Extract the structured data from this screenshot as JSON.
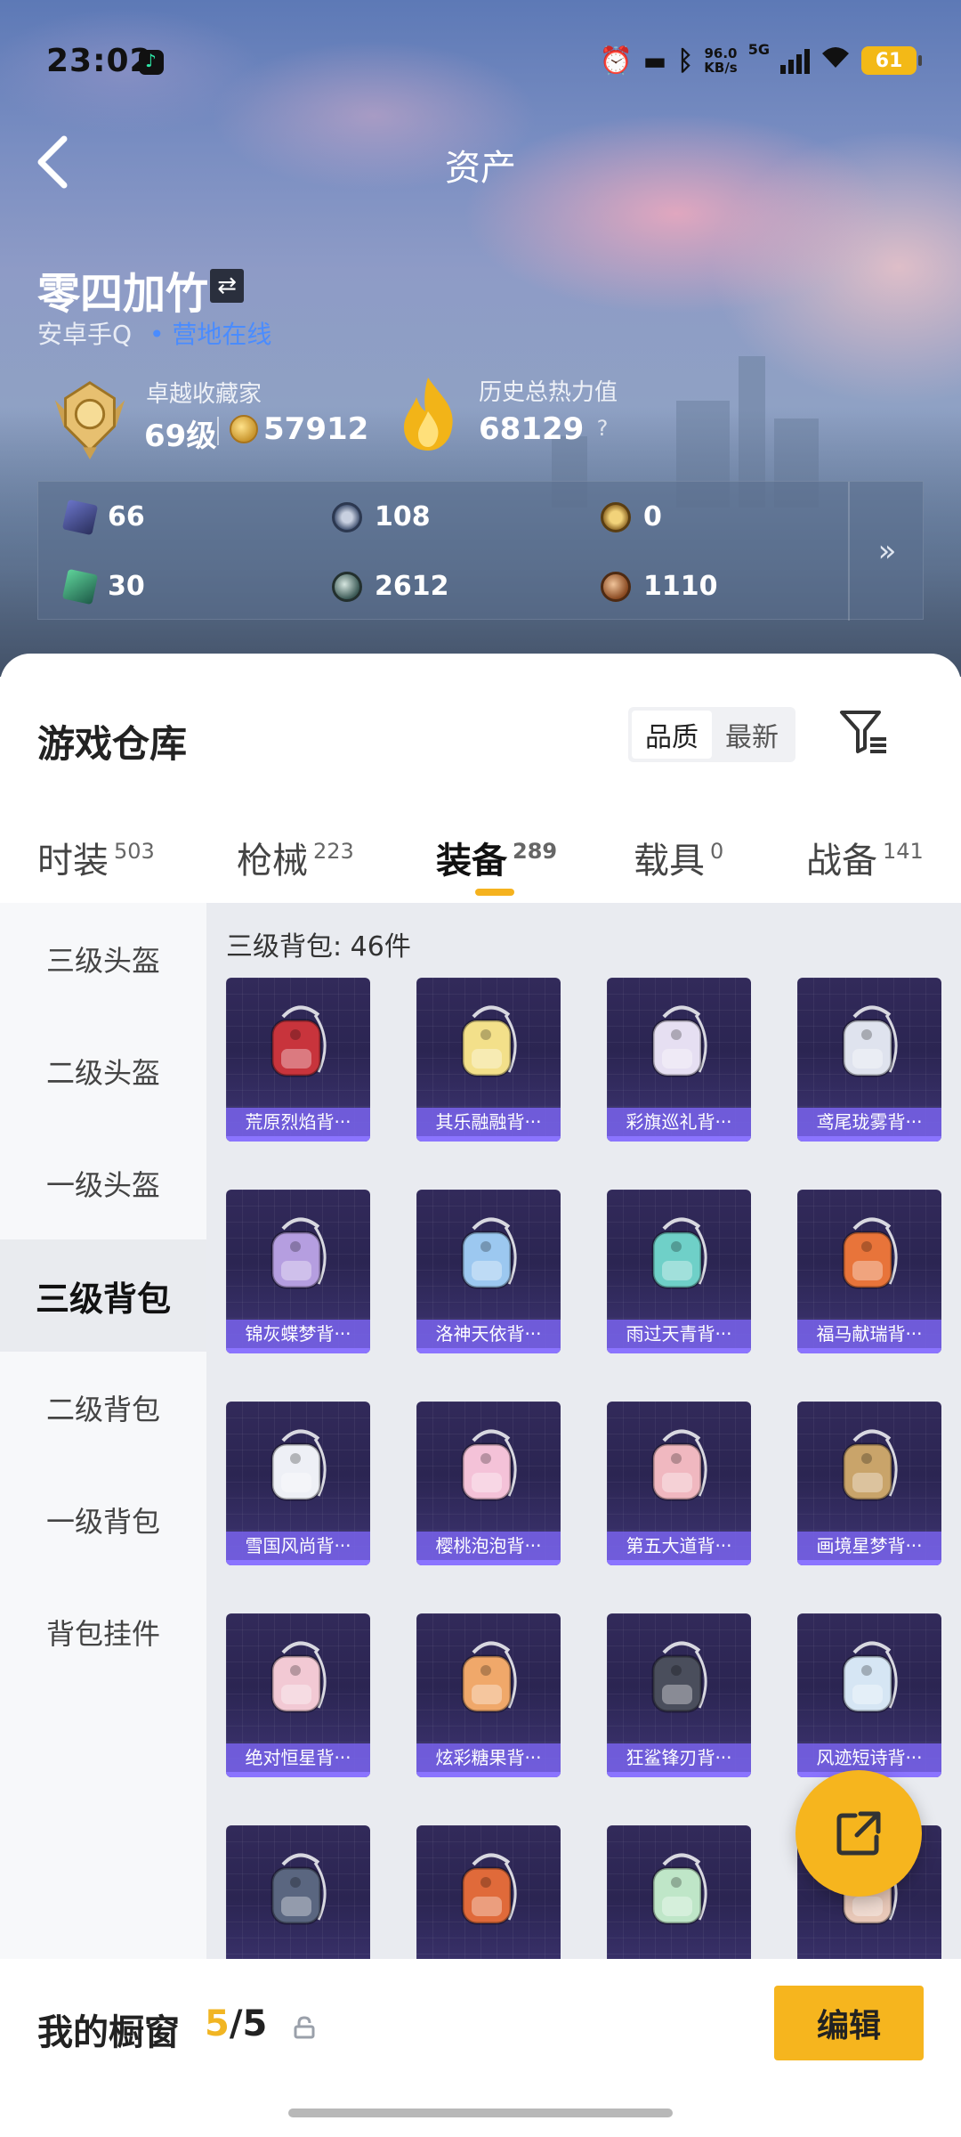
{
  "status_bar": {
    "time": "23:02",
    "net_speed_value": "96.0",
    "net_speed_unit": "KB/s",
    "network_type": "5G",
    "battery": "61"
  },
  "header": {
    "title": "资产"
  },
  "profile": {
    "name": "零四加竹",
    "platform": "安卓手Q",
    "online_status": "• 营地在线",
    "collector_title": "卓越收藏家",
    "level": "69级",
    "collection_points": "57912",
    "heat_label": "历史总热力值",
    "heat_value": "68129",
    "help_symbol": "?"
  },
  "resources": [
    {
      "icon": "card-icon",
      "value": "66"
    },
    {
      "icon": "gear-badge-icon",
      "value": "108"
    },
    {
      "icon": "gold-emblem-icon",
      "value": "0"
    },
    {
      "icon": "green-card-icon",
      "value": "30"
    },
    {
      "icon": "silver-orb-icon",
      "value": "2612"
    },
    {
      "icon": "bronze-coin-icon",
      "value": "1110"
    }
  ],
  "resources_more": "»",
  "warehouse": {
    "title": "游戏仓库",
    "sort_options": [
      "品质",
      "最新"
    ],
    "active_sort": "品质"
  },
  "tabs": [
    {
      "label": "时装",
      "count": "503"
    },
    {
      "label": "枪械",
      "count": "223"
    },
    {
      "label": "装备",
      "count": "289"
    },
    {
      "label": "载具",
      "count": "0"
    },
    {
      "label": "战备",
      "count": "141"
    }
  ],
  "active_tab": "装备",
  "sidebar": [
    {
      "label": "三级头盔"
    },
    {
      "label": "二级头盔"
    },
    {
      "label": "一级头盔"
    },
    {
      "label": "三级背包"
    },
    {
      "label": "二级背包"
    },
    {
      "label": "一级背包"
    },
    {
      "label": "背包挂件"
    }
  ],
  "active_category": "三级背包",
  "content_header": "三级背包: 46件",
  "items": [
    {
      "name": "荒原烈焰背···",
      "color": "#c8343c"
    },
    {
      "name": "其乐融融背···",
      "color": "#f3e08a"
    },
    {
      "name": "彩旗巡礼背···",
      "color": "#e6dff2"
    },
    {
      "name": "鸢尾珑雾背···",
      "color": "#dfe3ee"
    },
    {
      "name": "锦灰蝶梦背···",
      "color": "#b59ee0"
    },
    {
      "name": "洛神天依背···",
      "color": "#9cc8f0"
    },
    {
      "name": "雨过天青背···",
      "color": "#6fd0c8"
    },
    {
      "name": "福马献瑞背···",
      "color": "#e8743a"
    },
    {
      "name": "雪国风尚背···",
      "color": "#eef0f6"
    },
    {
      "name": "樱桃泡泡背···",
      "color": "#f4c2d8"
    },
    {
      "name": "第五大道背···",
      "color": "#f0b8c0"
    },
    {
      "name": "画境星梦背···",
      "color": "#c9a46a"
    },
    {
      "name": "绝对恒星背···",
      "color": "#f2c9d4"
    },
    {
      "name": "炫彩糖果背···",
      "color": "#f0a86a"
    },
    {
      "name": "狂鲨锋刃背···",
      "color": "#4a4e5c"
    },
    {
      "name": "风迹短诗背···",
      "color": "#d6e6f4"
    },
    {
      "name": "",
      "color": "#5a6680"
    },
    {
      "name": "",
      "color": "#e06a3a"
    },
    {
      "name": "",
      "color": "#bfe6c8"
    },
    {
      "name": "",
      "color": "#e8c8b8"
    }
  ],
  "footer": {
    "showcase_label": "我的橱窗",
    "showcase_current": "5",
    "showcase_total": "/5",
    "edit_label": "编辑"
  },
  "colors": {
    "accent": "#f6b51e",
    "online": "#4a8cff",
    "item_label_bg": "#7660e6",
    "card_bg": "#2b2552"
  }
}
